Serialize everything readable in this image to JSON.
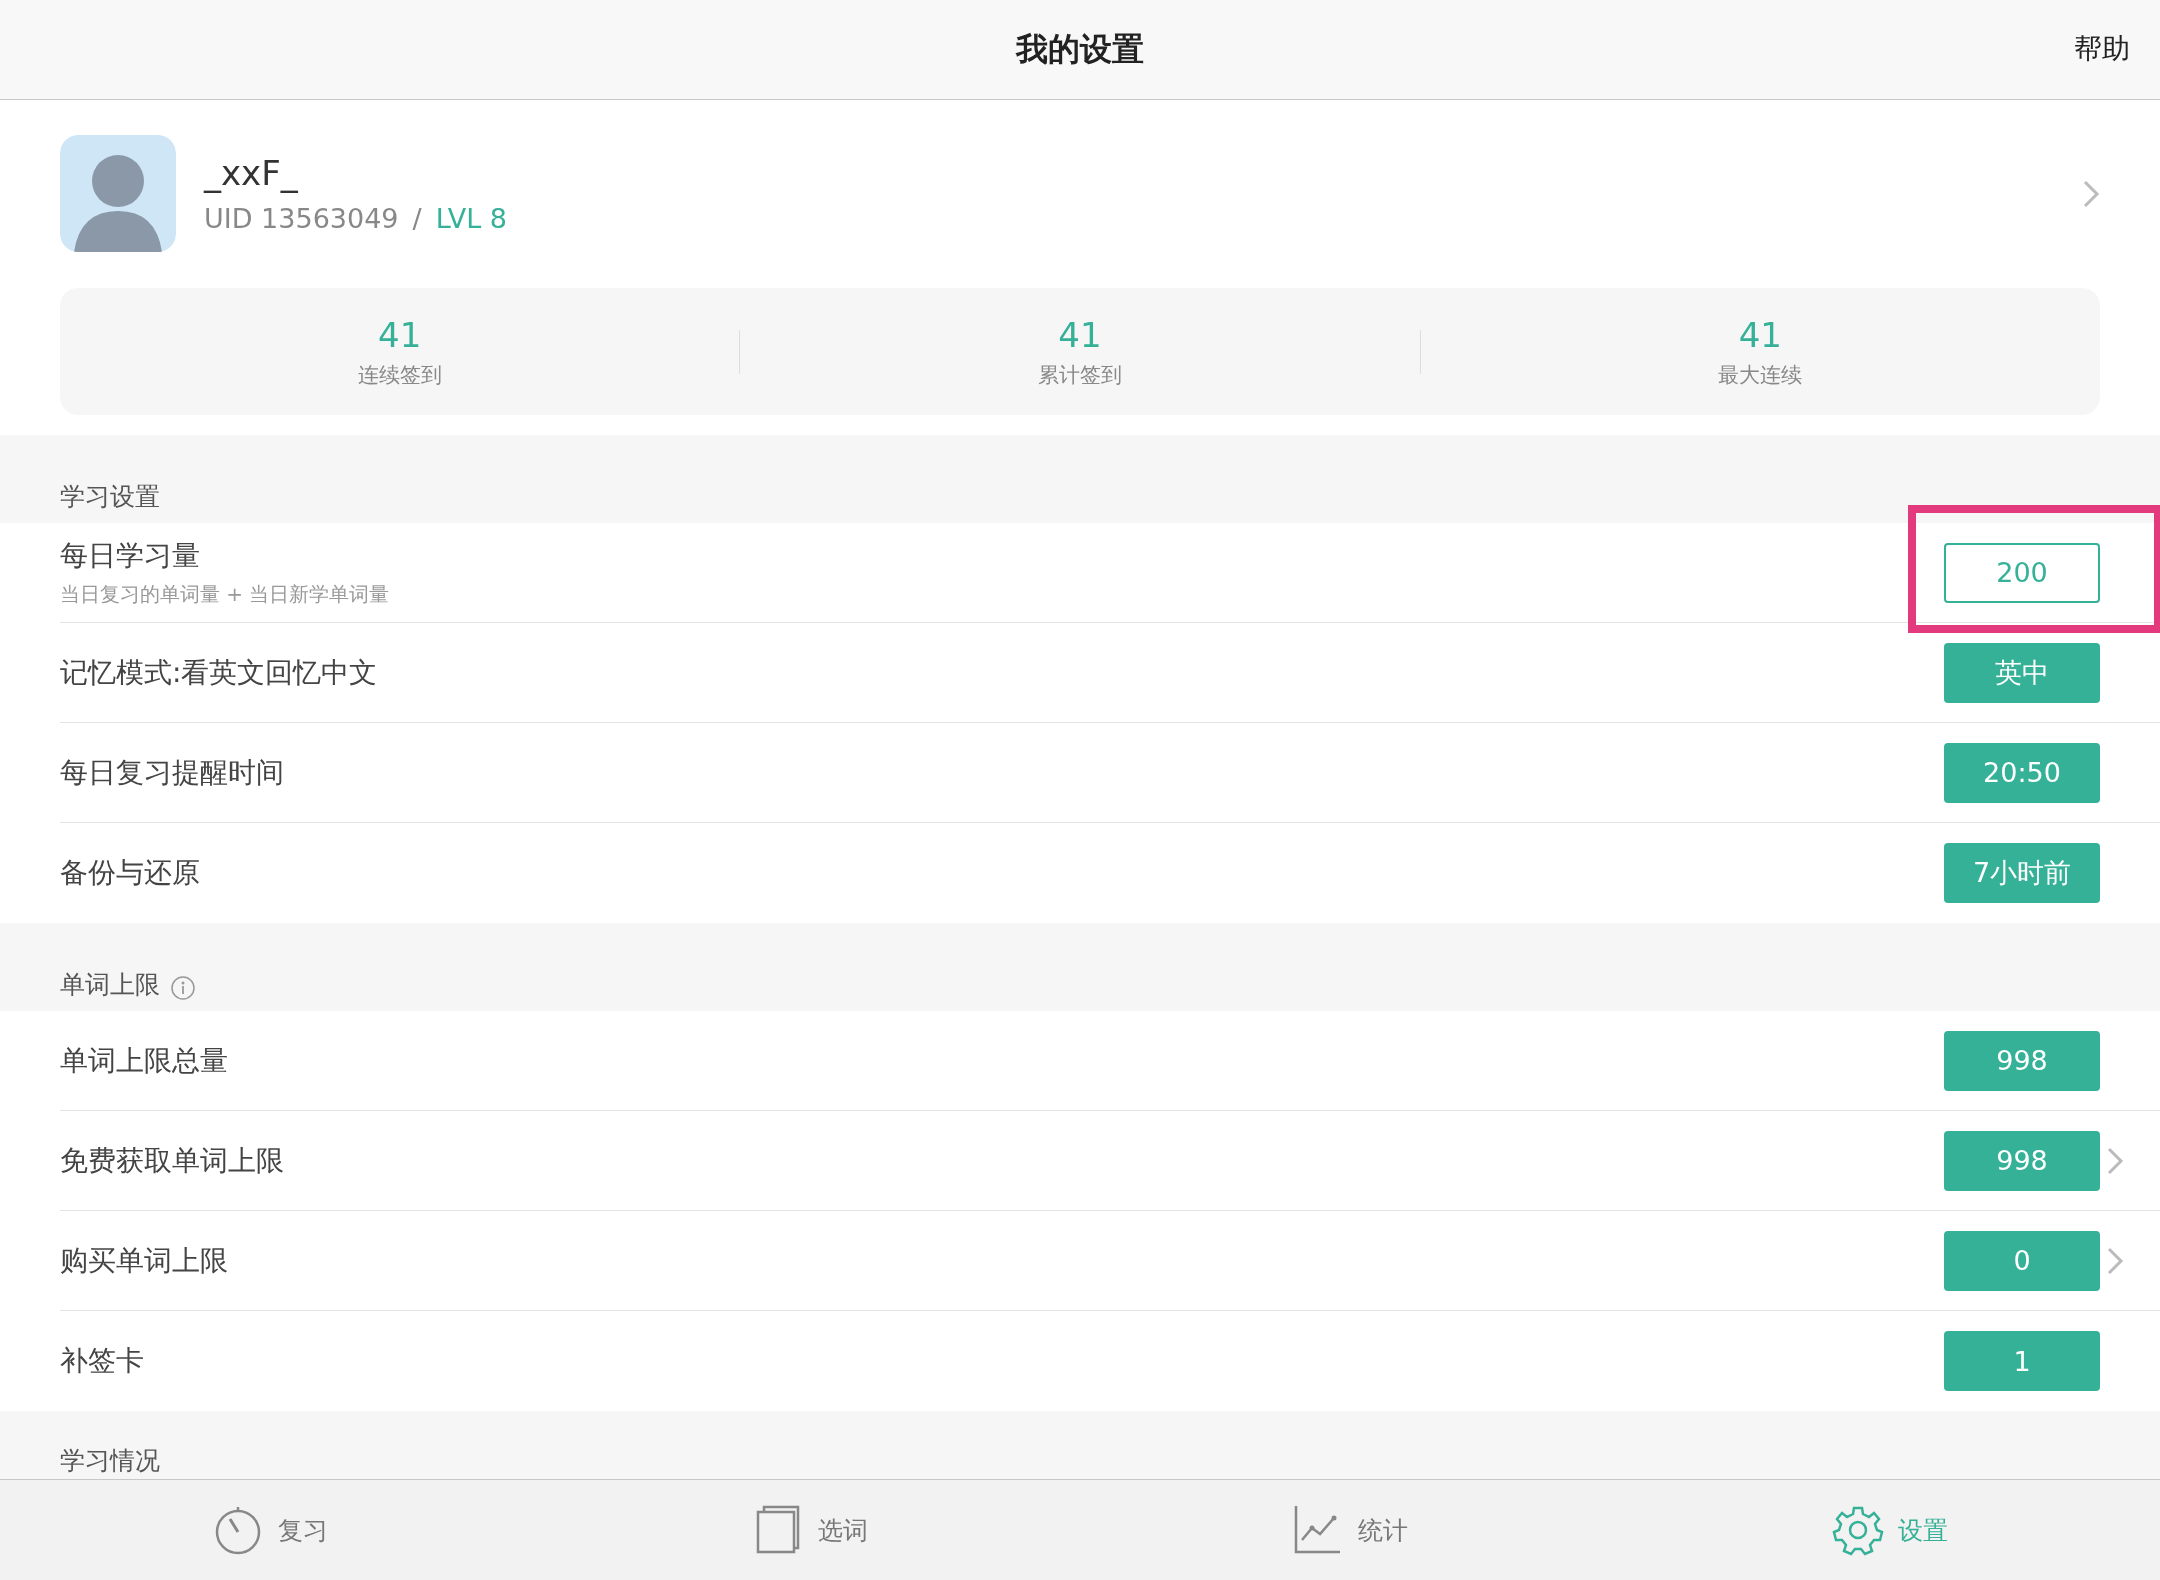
{
  "nav": {
    "title": "我的设置",
    "action": "帮助"
  },
  "profile": {
    "name": "_xxF_",
    "uid": "UID 13563049",
    "separator": "/",
    "level": "LVL 8"
  },
  "stats": [
    {
      "value": "41",
      "label": "连续签到"
    },
    {
      "value": "41",
      "label": "累计签到"
    },
    {
      "value": "41",
      "label": "最大连续"
    }
  ],
  "sections": [
    {
      "title": "学习设置",
      "info": false,
      "rows": [
        {
          "label": "每日学习量",
          "subtitle": "当日复习的单词量 + 当日新学单词量",
          "value": "200",
          "kind": "outline",
          "chevron": false,
          "annotated": true
        },
        {
          "label": "记忆模式:看英文回忆中文",
          "value": "英中",
          "kind": "filled",
          "chevron": false,
          "annotated": false
        },
        {
          "label": "每日复习提醒时间",
          "value": "20:50",
          "kind": "filled",
          "chevron": false,
          "annotated": false
        },
        {
          "label": "备份与还原",
          "value": "7小时前",
          "kind": "filled",
          "chevron": false,
          "annotated": false
        }
      ]
    },
    {
      "title": "单词上限",
      "info": true,
      "rows": [
        {
          "label": "单词上限总量",
          "value": "998",
          "kind": "filled",
          "chevron": false,
          "annotated": false
        },
        {
          "label": "免费获取单词上限",
          "value": "998",
          "kind": "filled",
          "chevron": true,
          "annotated": false
        },
        {
          "label": "购买单词上限",
          "value": "0",
          "kind": "filled",
          "chevron": true,
          "annotated": false
        },
        {
          "label": "补签卡",
          "value": "1",
          "kind": "filled",
          "chevron": false,
          "annotated": false
        }
      ]
    },
    {
      "title": "学习情况",
      "info": false
    }
  ],
  "tabs": [
    {
      "label": "复习",
      "kind": "timer",
      "selected": false
    },
    {
      "label": "选词",
      "kind": "book",
      "selected": false
    },
    {
      "label": "统计",
      "kind": "chart",
      "selected": false
    },
    {
      "label": "设置",
      "kind": "gear",
      "selected": true
    }
  ]
}
